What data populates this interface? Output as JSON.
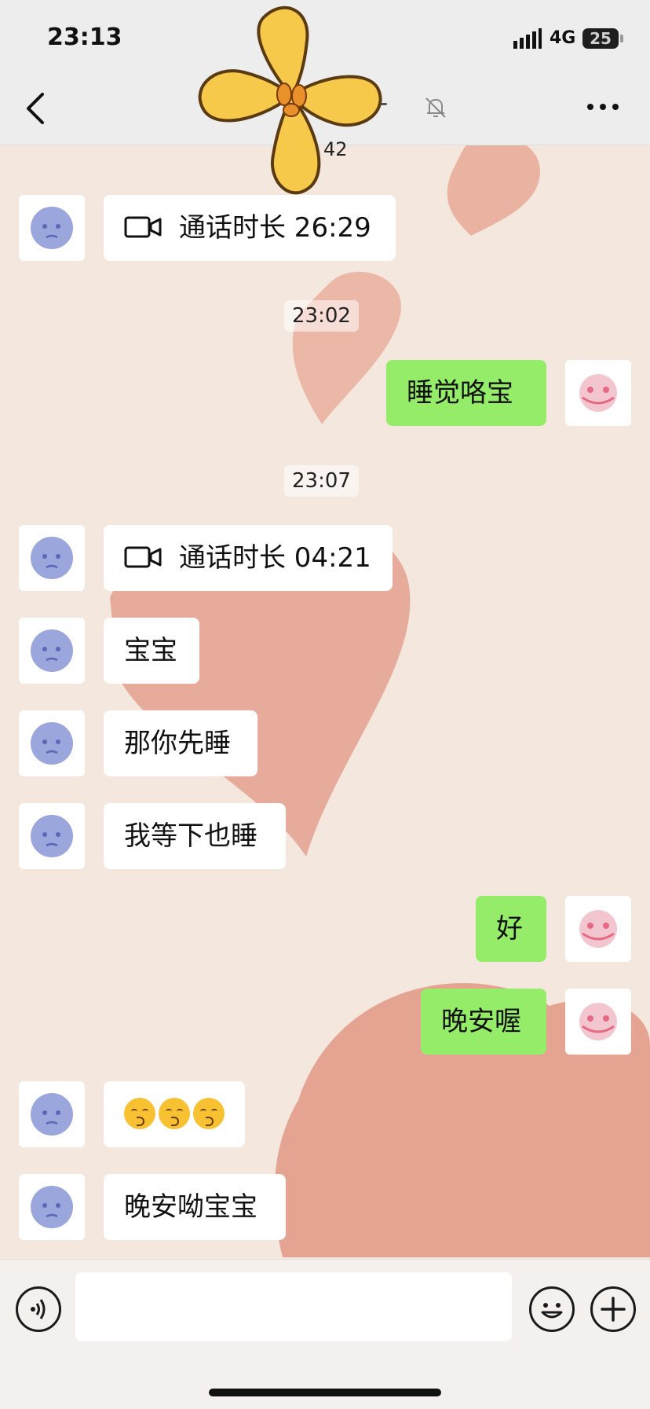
{
  "status_bar": {
    "time": "23:13",
    "network": "4G",
    "battery": "25"
  },
  "nav": {
    "title_fragment": "´-",
    "partial_timestamp": "42"
  },
  "messages": [
    {
      "type": "call",
      "side": "in",
      "text": "通话时长 26:29"
    },
    {
      "type": "timestamp",
      "text": "23:02"
    },
    {
      "type": "text",
      "side": "out",
      "text": "睡觉咯宝"
    },
    {
      "type": "timestamp",
      "text": "23:07"
    },
    {
      "type": "call",
      "side": "in",
      "text": "通话时长 04:21"
    },
    {
      "type": "text",
      "side": "in",
      "text": "宝宝"
    },
    {
      "type": "text",
      "side": "in",
      "text": "那你先睡"
    },
    {
      "type": "text",
      "side": "in",
      "text": "我等下也睡"
    },
    {
      "type": "text",
      "side": "out",
      "text": "好"
    },
    {
      "type": "text",
      "side": "out",
      "text": "晚安喔"
    },
    {
      "type": "emoji",
      "side": "in",
      "emoji_count": 3,
      "emoji": "kissing-smiling-eyes"
    },
    {
      "type": "text",
      "side": "in",
      "text": "晚安呦宝宝"
    }
  ],
  "colors": {
    "outgoing_bubble": "#95ec69",
    "incoming_bubble": "#ffffff",
    "nav_background": "#ededed",
    "chat_background": "#f3e6dc",
    "heart_background": "#e6a493"
  },
  "icons": {
    "back": "chevron-left-icon",
    "mute": "bell-off-icon",
    "more": "more-dots-icon",
    "call": "video-call-icon",
    "voice": "voice-icon",
    "emoji": "emoji-icon",
    "plus": "plus-icon"
  }
}
